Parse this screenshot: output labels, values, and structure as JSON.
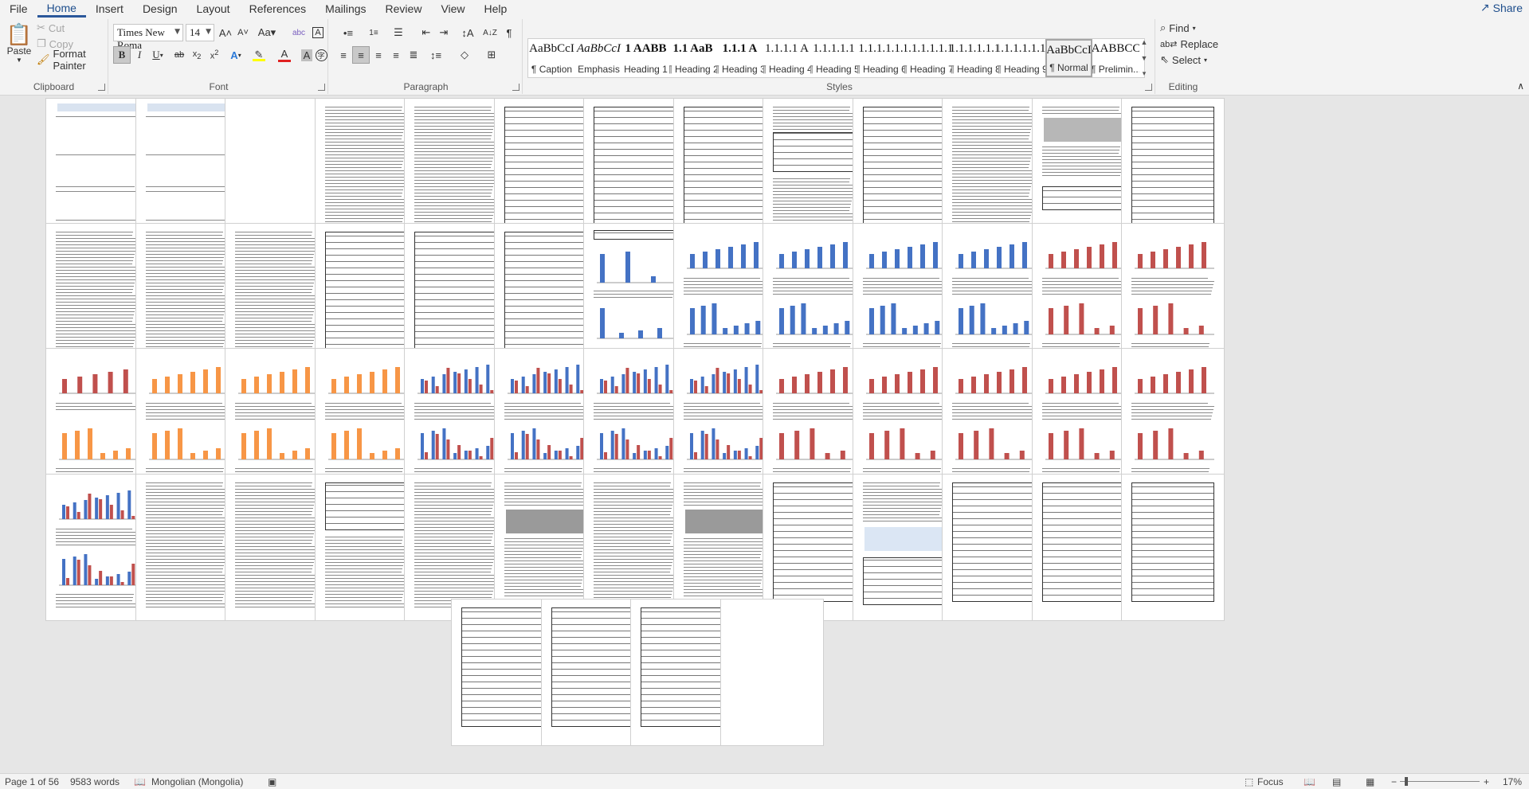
{
  "tabs": [
    "File",
    "Home",
    "Insert",
    "Design",
    "Layout",
    "References",
    "Mailings",
    "Review",
    "View",
    "Help"
  ],
  "active_tab": "Home",
  "share_label": "Share",
  "clipboard": {
    "paste": "Paste",
    "cut": "Cut",
    "copy": "Copy",
    "format_painter": "Format Painter",
    "label": "Clipboard"
  },
  "font": {
    "family": "Times New Roma",
    "size": "14",
    "label": "Font"
  },
  "paragraph": {
    "label": "Paragraph"
  },
  "styles": {
    "label": "Styles",
    "items": [
      {
        "sample": "AaBbCcI",
        "name": "¶ Caption"
      },
      {
        "sample": "AaBbCcI",
        "name": "Emphasis"
      },
      {
        "sample": "1 AABB",
        "name": "Heading 1"
      },
      {
        "sample": "1.1 AaB",
        "name": "¶ Heading 2"
      },
      {
        "sample": "1.1.1 A",
        "name": "¶ Heading 3"
      },
      {
        "sample": "1.1.1.1 A",
        "name": "¶ Heading 4"
      },
      {
        "sample": "1.1.1.1.1",
        "name": "¶ Heading 5"
      },
      {
        "sample": "1.1.1.1.1.",
        "name": "¶ Heading 6"
      },
      {
        "sample": "1.1.1.1.1.1",
        "name": "¶ Heading 7"
      },
      {
        "sample": "1.1.1.1.1.1",
        "name": "¶ Heading 8"
      },
      {
        "sample": "1.1.1.1.1.1.",
        "name": "¶ Heading 9"
      },
      {
        "sample": "AaBbCcI",
        "name": "¶ Normal"
      },
      {
        "sample": "AABBCC",
        "name": "¶ Prelimin..."
      }
    ],
    "selected": 11
  },
  "editing": {
    "find": "Find",
    "replace": "Replace",
    "select": "Select",
    "label": "Editing"
  },
  "status": {
    "page": "Page 1 of 56",
    "words": "9583 words",
    "language": "Mongolian (Mongolia)",
    "focus": "Focus",
    "zoom": "17%"
  },
  "colors": {
    "accent": "#2b579a",
    "font_color": "#e02020",
    "highlight": "#ffff00",
    "chart_blue": "#4472c4",
    "chart_red": "#c0504d",
    "chart_orange": "#f79646"
  },
  "pages": [
    "cover",
    "cover",
    "blank",
    "text",
    "text",
    "table",
    "table",
    "table",
    "mixed",
    "table",
    "text",
    "image",
    "table",
    "text",
    "text",
    "text",
    "table",
    "table",
    "table",
    "bar-blue",
    "chart-blue",
    "chart-blue",
    "chart-blue",
    "chart-blue",
    "chart-red",
    "chart-red",
    "chart-mixed",
    "chart-orange",
    "chart-orange",
    "chart-orange",
    "chart-duo",
    "chart-duo",
    "chart-duo",
    "chart-duo",
    "chart-red",
    "chart-red",
    "chart-red",
    "chart-red",
    "chart-red",
    "chart-duo",
    "text",
    "text",
    "form",
    "text",
    "photos",
    "text",
    "photos",
    "table",
    "diagram",
    "table",
    "table",
    "table",
    "table",
    "table",
    "table",
    "blank"
  ]
}
